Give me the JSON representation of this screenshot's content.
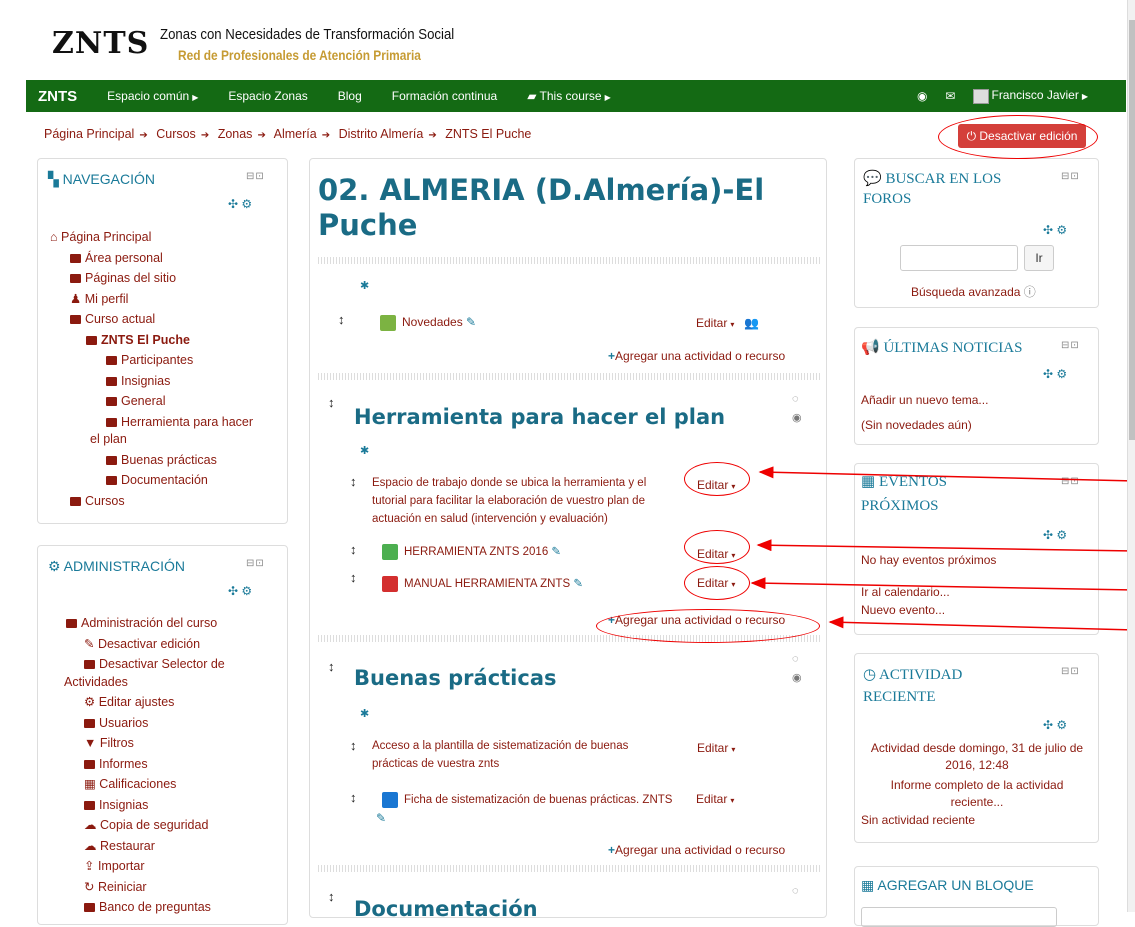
{
  "header": {
    "logo": "ZNTS",
    "site_title": "Zonas con Necesidades de Transformación Social",
    "site_subtitle": "Red de Profesionales de Atención Primaria"
  },
  "navbar": {
    "brand": "ZNTS",
    "items": [
      "Espacio común",
      "Espacio Zonas",
      "Blog",
      "Formación continua",
      "This course"
    ],
    "user": "Francisco Javier"
  },
  "breadcrumb": [
    "Página Principal",
    "Cursos",
    "Zonas",
    "Almería",
    "Distrito Almería",
    "ZNTS El Puche"
  ],
  "edit_toggle": "Desactivar edición",
  "nav_block": {
    "title": "NAVEGACIÓN",
    "items": [
      "Página Principal",
      "Área personal",
      "Páginas del sitio",
      "Mi perfil",
      "Curso actual",
      "ZNTS El Puche",
      "Participantes",
      "Insignias",
      "General",
      "Herramienta para hacer",
      "el plan",
      "Buenas prácticas",
      "Documentación",
      "Cursos"
    ]
  },
  "admin_block": {
    "title": "ADMINISTRACIÓN",
    "items": [
      "Administración del curso",
      "Desactivar edición",
      "Desactivar Selector de",
      "Actividades",
      "Editar ajustes",
      "Usuarios",
      "Filtros",
      "Informes",
      "Calificaciones",
      "Insignias",
      "Copia de seguridad",
      "Restaurar",
      "Importar",
      "Reiniciar",
      "Banco de preguntas"
    ]
  },
  "main": {
    "title": "02. ALMERIA (D.Almería)-El Puche",
    "news_label": "Novedades",
    "edit": "Editar",
    "add": "Agregar una actividad o recurso",
    "s1_title": "Herramienta para hacer el plan",
    "s1_desc": [
      "Espacio de trabajo donde se ubica la herramienta y el",
      "tutorial para facilitar la elaboración de vuestro plan de",
      "actuación en salud (intervención y evaluación)"
    ],
    "s1_file1": "HERRAMIENTA ZNTS 2016",
    "s1_file2": "MANUAL HERRAMIENTA ZNTS",
    "s2_title": "Buenas prácticas",
    "s2_desc": [
      "Acceso a la plantilla de sistematización de buenas",
      "prácticas de vuestra znts"
    ],
    "s2_file": "Ficha de sistematización de buenas prácticas. ZNTS",
    "s3_title": "Documentación"
  },
  "search_block": {
    "title1": "BUSCAR EN LOS",
    "title2": "FOROS",
    "button": "Ir",
    "advanced": "Búsqueda avanzada"
  },
  "news_block": {
    "title": "ÚLTIMAS NOTICIAS",
    "add": "Añadir un nuevo tema...",
    "none": "(Sin novedades aún)"
  },
  "events_block": {
    "title1": "EVENTOS",
    "title2": "PRÓXIMOS",
    "none": "No hay eventos próximos",
    "calendar": "Ir al calendario...",
    "new": "Nuevo evento..."
  },
  "recent_block": {
    "title1": "ACTIVIDAD",
    "title2": "RECIENTE",
    "since1": "Actividad desde domingo, 31 de julio de",
    "since2": "2016, 12:48",
    "report1": "Informe completo de la actividad",
    "report2": "reciente...",
    "none": "Sin actividad reciente"
  },
  "addblock_block": {
    "title": "AGREGAR UN BLOQUE"
  },
  "colors": {
    "nav_green": "#146a14",
    "link": "#8b1a0f",
    "heading": "#1a6b85",
    "danger": "#d43f3a",
    "annotation": "#e00000"
  }
}
